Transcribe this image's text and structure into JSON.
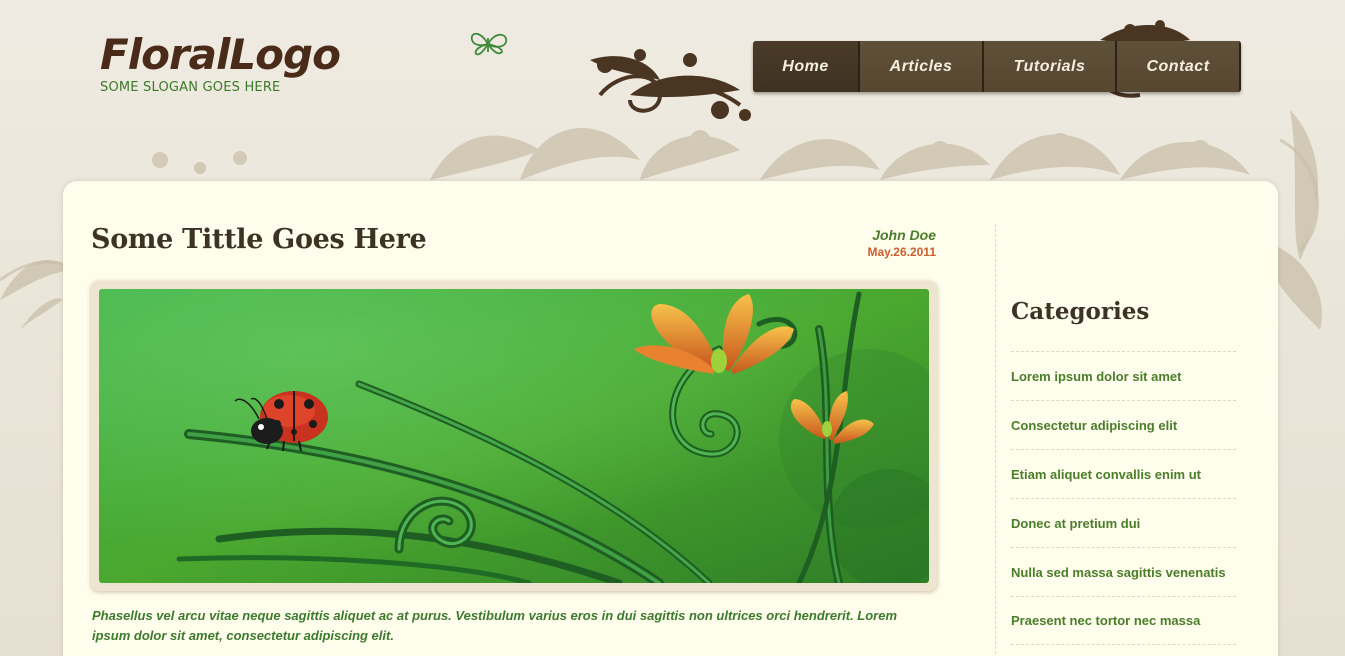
{
  "header": {
    "logo": "FloralLogo",
    "slogan": "SOME SLOGAN GOES HERE"
  },
  "nav": {
    "items": [
      {
        "label": "Home"
      },
      {
        "label": "Articles"
      },
      {
        "label": "Tutorials"
      },
      {
        "label": "Contact"
      }
    ]
  },
  "post": {
    "title": "Some Tittle Goes Here",
    "author": "John Doe",
    "date": "May.26.2011",
    "image": "ladybug-on-grass-illustration",
    "excerpt": "Phasellus vel arcu vitae neque sagittis aliquet ac at purus. Vestibulum varius eros in dui sagittis non ultrices orci hendrerit. Lorem ipsum dolor sit amet, consectetur adipiscing elit."
  },
  "sidebar": {
    "title": "Categories",
    "items": [
      {
        "label": "Lorem ipsum dolor sit amet"
      },
      {
        "label": "Consectetur adipiscing elit"
      },
      {
        "label": "Etiam aliquet convallis enim ut"
      },
      {
        "label": "Donec at pretium dui"
      },
      {
        "label": "Nulla sed massa sagittis venenatis"
      },
      {
        "label": "Praesent nec tortor nec massa"
      }
    ]
  },
  "colors": {
    "nav_bg": "#574731",
    "link_green": "#4b7d2b",
    "date_orange": "#c9602e",
    "content_bg": "#fffdeb"
  }
}
